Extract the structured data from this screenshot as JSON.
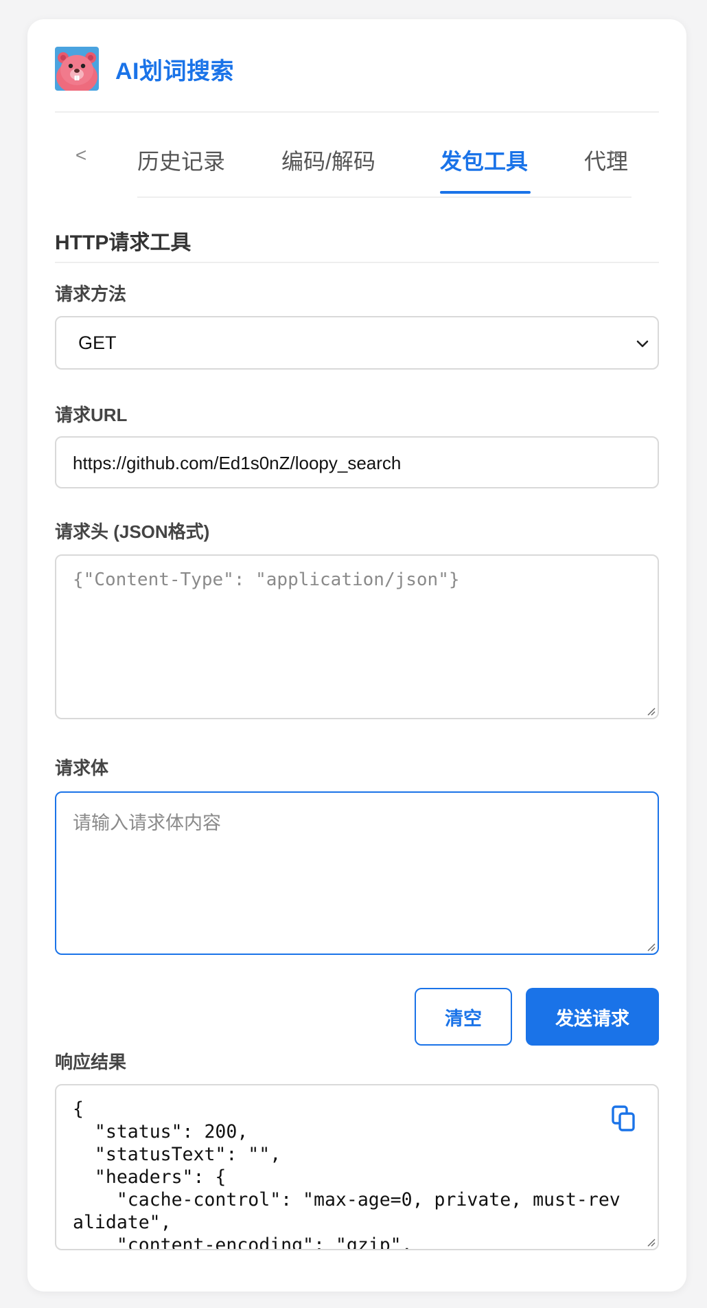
{
  "app": {
    "title": "AI划词搜索",
    "logo_icon": "beaver-logo-icon"
  },
  "tabs": {
    "prev_arrow": "<",
    "next_arrow": ">",
    "items": [
      {
        "label": "历史记录",
        "active": false
      },
      {
        "label": "编码/解码",
        "active": false
      },
      {
        "label": "发包工具",
        "active": true
      },
      {
        "label": "代理",
        "active": false
      }
    ]
  },
  "section": {
    "title": "HTTP请求工具"
  },
  "form": {
    "method_label": "请求方法",
    "method_value": "GET",
    "url_label": "请求URL",
    "url_value": "https://github.com/Ed1s0nZ/loopy_search",
    "headers_label": "请求头 (JSON格式)",
    "headers_placeholder": "{\"Content-Type\": \"application/json\"}",
    "body_label": "请求体",
    "body_placeholder": "请输入请求体内容"
  },
  "actions": {
    "clear_label": "清空",
    "send_label": "发送请求"
  },
  "response": {
    "label": "响应结果",
    "text": "{\n  \"status\": 200,\n  \"statusText\": \"\",\n  \"headers\": {\n    \"cache-control\": \"max-age=0, private, must-revalidate\",\n    \"content-encoding\": \"gzip\","
  },
  "colors": {
    "accent": "#1a73e8",
    "border": "#d9d9d9",
    "background": "#f4f4f5"
  },
  "icons": {
    "dropdown": "chevron-down-icon",
    "copy": "copy-icon",
    "resize": "resize-grip-icon"
  }
}
